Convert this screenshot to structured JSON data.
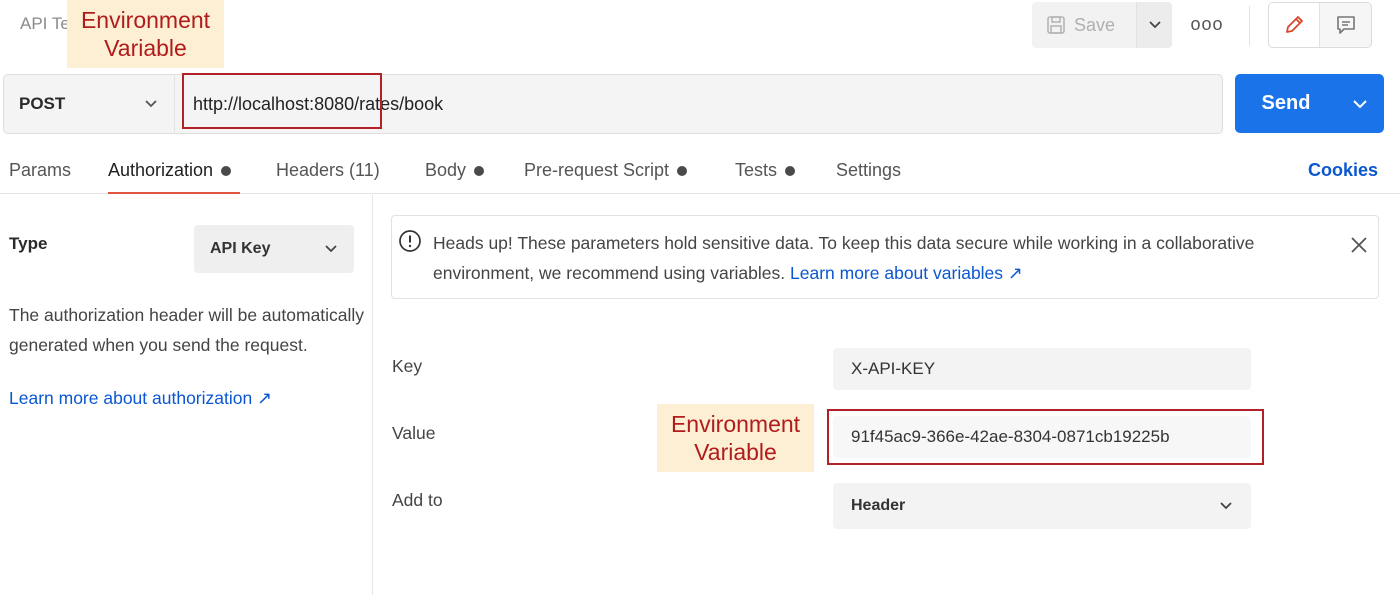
{
  "header": {
    "title": "API Te",
    "save_label": "Save",
    "more_label": "ooo"
  },
  "request": {
    "method": "POST",
    "url": "http://localhost:8080/rates/book",
    "send_label": "Send"
  },
  "tabs": [
    {
      "label": "Params",
      "dot": false
    },
    {
      "label": "Authorization",
      "dot": true
    },
    {
      "label": "Headers (11)",
      "dot": false
    },
    {
      "label": "Body",
      "dot": true
    },
    {
      "label": "Pre-request Script",
      "dot": true
    },
    {
      "label": "Tests",
      "dot": true
    },
    {
      "label": "Settings",
      "dot": false
    }
  ],
  "cookies_label": "Cookies",
  "auth": {
    "type_label": "Type",
    "type_value": "API Key",
    "description": "The authorization header will be automatically generated when you send the request.",
    "learn_more": "Learn more about authorization ↗"
  },
  "alert": {
    "text": "Heads up! These parameters hold sensitive data. To keep this data secure while working in a collaborative environment, we recommend using variables.",
    "link": "Learn more about variables ↗"
  },
  "form": {
    "key_label": "Key",
    "key_value": "X-API-KEY",
    "value_label": "Value",
    "value_value": "91f45ac9-366e-42ae-8304-0871cb19225b",
    "addto_label": "Add to",
    "addto_value": "Header"
  },
  "annotations": {
    "top": "Environment Variable",
    "middle": "Environment Variable"
  },
  "colors": {
    "accent": "#1a73e8",
    "link": "#0b57d0",
    "active_tab_underline": "#e0543a",
    "annotation_border": "#b32025",
    "annotation_bg": "#fdefd3"
  }
}
